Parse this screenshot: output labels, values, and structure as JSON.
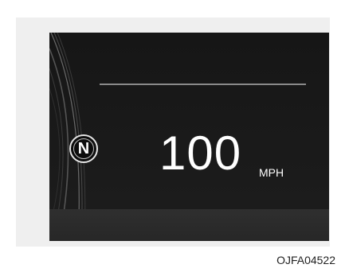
{
  "cluster": {
    "gear_position": "N",
    "speed_value": "100",
    "speed_unit": "MPH"
  },
  "figure_code": "OJFA04522"
}
